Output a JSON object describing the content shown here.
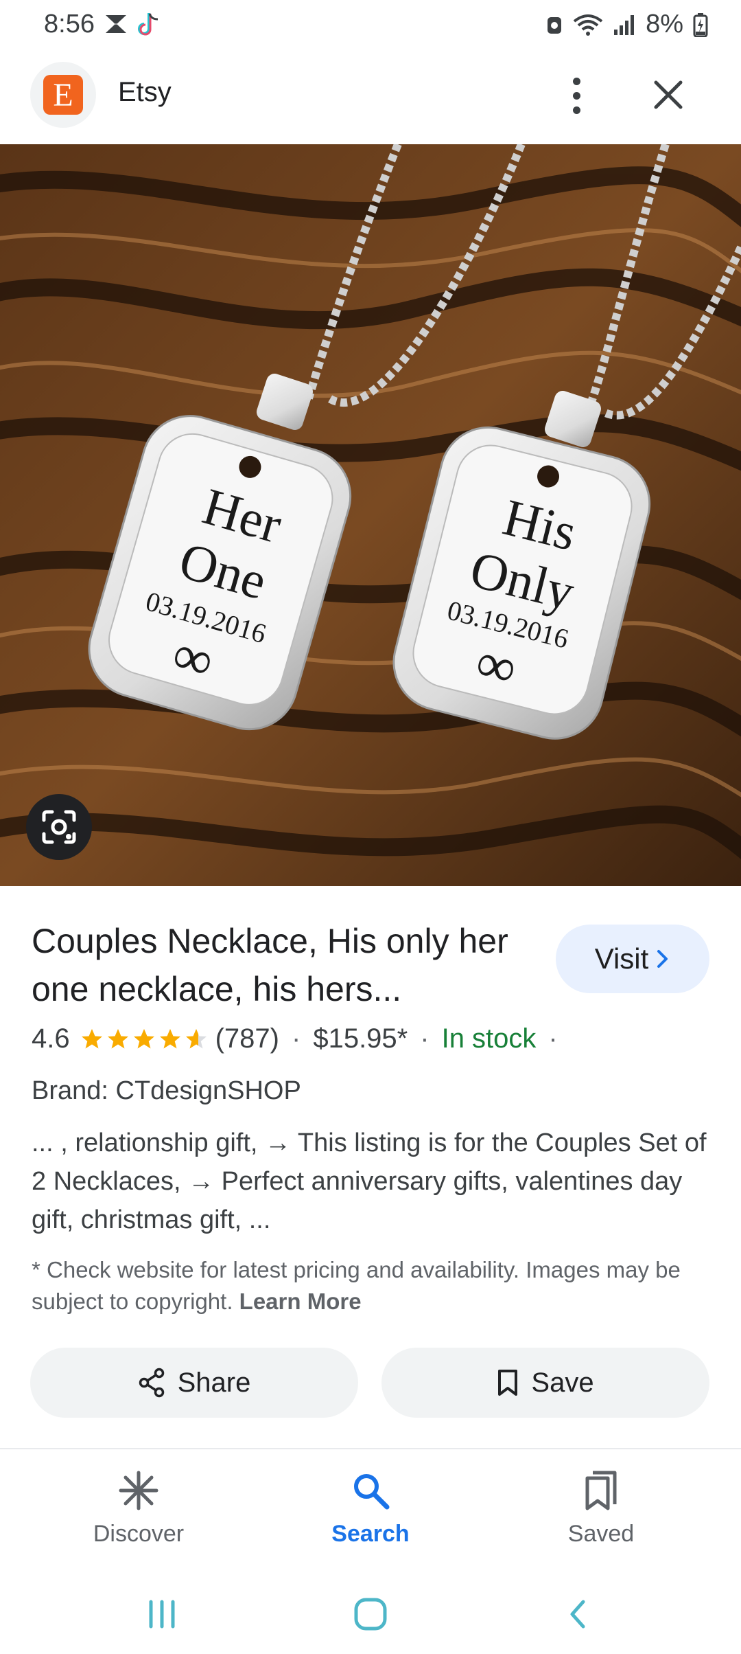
{
  "status_bar": {
    "time": "8:56",
    "battery": "8%"
  },
  "header": {
    "logo_letter": "E",
    "site_name": "Etsy"
  },
  "image": {
    "tag_left_line1": "Her",
    "tag_left_line2": "One",
    "tag_left_date": "03.19.2016",
    "tag_right_line1": "His",
    "tag_right_line2": "Only",
    "tag_right_date": "03.19.2016",
    "infinity": "∞"
  },
  "product": {
    "title": "Couples Necklace, His only her one necklace, his hers...",
    "visit_label": "Visit",
    "rating": "4.6",
    "rating_stars": 4.6,
    "reviews": "(787)",
    "price": "$15.95*",
    "stock": "In stock",
    "separator": "·",
    "brand": "Brand: CTdesignSHOP",
    "description": "... , relationship gift, → This listing is for the Couples Set of 2 Necklaces, → Perfect anniversary gifts, valentines day gift, christmas gift, ...",
    "disclaimer": "* Check website for latest pricing and availability. Images may be subject to copyright.",
    "learn_more": "Learn More"
  },
  "actions": {
    "share_label": "Share",
    "save_label": "Save"
  },
  "bottom_nav": {
    "items": [
      {
        "label": "Discover",
        "icon": "asterisk-icon"
      },
      {
        "label": "Search",
        "icon": "search-icon",
        "active": true
      },
      {
        "label": "Saved",
        "icon": "bookmarks-icon"
      }
    ]
  },
  "colors": {
    "accent": "#1a73e8",
    "etsy_orange": "#f1641e",
    "in_stock": "#188038",
    "star": "#f9ab00"
  }
}
